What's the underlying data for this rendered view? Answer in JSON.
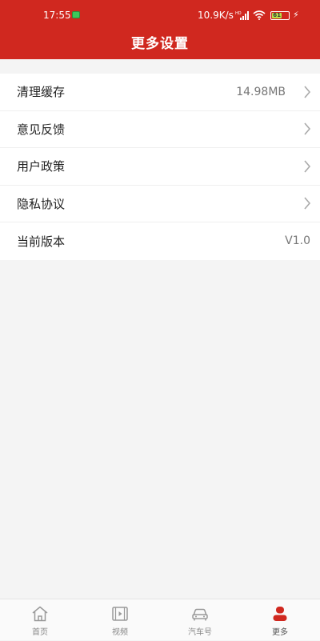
{
  "status_bar": {
    "time": "17:55",
    "net_speed": "10.9K/s",
    "battery_level": "61",
    "charging_icon": "lightning-icon"
  },
  "header": {
    "title": "更多设置"
  },
  "settings": {
    "items": [
      {
        "label": "清理缓存",
        "value": "14.98MB",
        "icon": "chevron-right-icon"
      },
      {
        "label": "意见反馈",
        "icon": "chevron-right-icon"
      },
      {
        "label": "用户政策",
        "icon": "chevron-right-icon"
      },
      {
        "label": "隐私协议",
        "icon": "chevron-right-icon"
      },
      {
        "label": "当前版本",
        "value": "V1.0"
      }
    ]
  },
  "tabbar": {
    "tabs": [
      {
        "label": "首页",
        "icon": "home-icon"
      },
      {
        "label": "视频",
        "icon": "video-icon"
      },
      {
        "label": "汽车号",
        "icon": "car-icon"
      },
      {
        "label": "更多",
        "icon": "person-icon",
        "active": true
      }
    ]
  },
  "colors": {
    "brand": "#d0281f",
    "background": "#f4f4f4"
  }
}
